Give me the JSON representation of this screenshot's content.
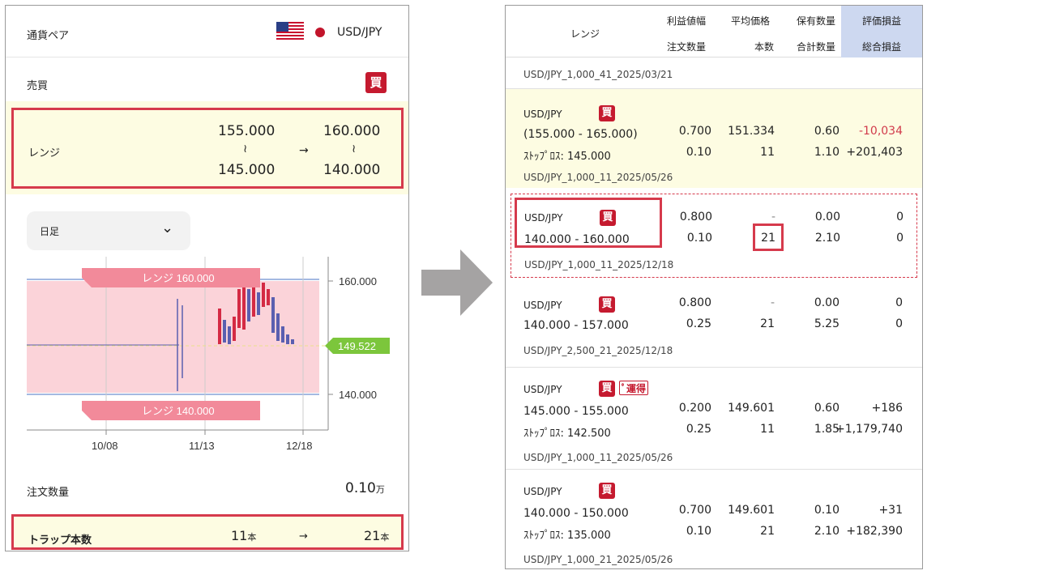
{
  "left": {
    "pair_label": "通貨ペア",
    "pair_value": "USD/JPY",
    "side_label": "売買",
    "side_badge": "買",
    "range_label": "レンジ",
    "range_from_high": "155.000",
    "range_from_low": "145.000",
    "range_to_high": "160.000",
    "range_to_low": "140.000",
    "tilde": "≀",
    "arrow": "→",
    "interval_select": "日足",
    "qty_label": "注文数量",
    "qty_value": "0.10",
    "qty_unit": "万",
    "trap_label": "トラップ本数",
    "trap_from": "11",
    "trap_to": "21",
    "trap_unit": "本"
  },
  "chart_data": {
    "type": "candlestick",
    "band_top_label": "レンジ 160.000",
    "band_bottom_label": "レンジ 140.000",
    "band_top": 160.0,
    "band_bottom": 140.0,
    "current_price": "149.522",
    "y_ticks": [
      "160.000",
      "140.000"
    ],
    "x_ticks": [
      "10/08",
      "11/13",
      "12/18"
    ],
    "colors": {
      "band": "#fbd3d9",
      "band_label": "#f28a9a",
      "up": "#d42a44",
      "down": "#5a5fb0",
      "current": "#7cc63c"
    }
  },
  "right": {
    "headers": {
      "range": "レンジ",
      "profit_width": "利益値幅",
      "order_qty": "注文数量",
      "avg_price": "平均価格",
      "count": "本数",
      "hold_qty": "保有数量",
      "total_qty": "合計数量",
      "eval_pnl": "評価損益",
      "total_pnl": "総合損益"
    },
    "groups": [
      "USD/JPY_1,000_41_2025/03/21",
      "USD/JPY_1,000_11_2025/05/26",
      "USD/JPY_1,000_11_2025/12/18",
      "USD/JPY_2,500_21_2025/12/18",
      "USD/JPY_1,000_11_2025/05/26",
      "USD/JPY_1,000_21_2025/05/26"
    ],
    "items": [
      {
        "pair": "USD/JPY",
        "badge": "買",
        "range": "(155.000  -  165.000)",
        "stop": "ｽﾄｯﾌﾟﾛｽ:    145.000",
        "profit": "0.700",
        "qty": "0.10",
        "avg": "151.334",
        "count": "11",
        "hold": "0.60",
        "total": "1.10",
        "eval": "-10,034",
        "pnl": "+201,403"
      },
      {
        "pair": "USD/JPY",
        "badge": "買",
        "range": "140.000    -    160.000",
        "profit": "0.800",
        "qty": "0.10",
        "avg": "-",
        "count": "21",
        "hold": "0.00",
        "total": "2.10",
        "eval": "0",
        "pnl": "0"
      },
      {
        "pair": "USD/JPY",
        "badge": "買",
        "range": "140.000    -    157.000",
        "profit": "0.800",
        "qty": "0.25",
        "avg": "-",
        "count": "21",
        "hold": "0.00",
        "total": "5.25",
        "eval": "0",
        "pnl": "0"
      },
      {
        "pair": "USD/JPY",
        "badge": "買",
        "note": "ﾟ運得",
        "range": "145.000    -    155.000",
        "stop": "ｽﾄｯﾌﾟﾛｽ:    142.500",
        "profit": "0.200",
        "qty": "0.25",
        "avg": "149.601",
        "count": "11",
        "hold": "0.60",
        "total": "1.85",
        "eval": "+186",
        "pnl": "+1,179,740"
      },
      {
        "pair": "USD/JPY",
        "badge": "買",
        "range": "140.000    -    150.000",
        "stop": "ｽﾄｯﾌﾟﾛｽ:    135.000",
        "profit": "0.700",
        "qty": "0.10",
        "avg": "149.601",
        "count": "21",
        "hold": "0.10",
        "total": "2.10",
        "eval": "+31",
        "pnl": "+182,390"
      }
    ]
  }
}
